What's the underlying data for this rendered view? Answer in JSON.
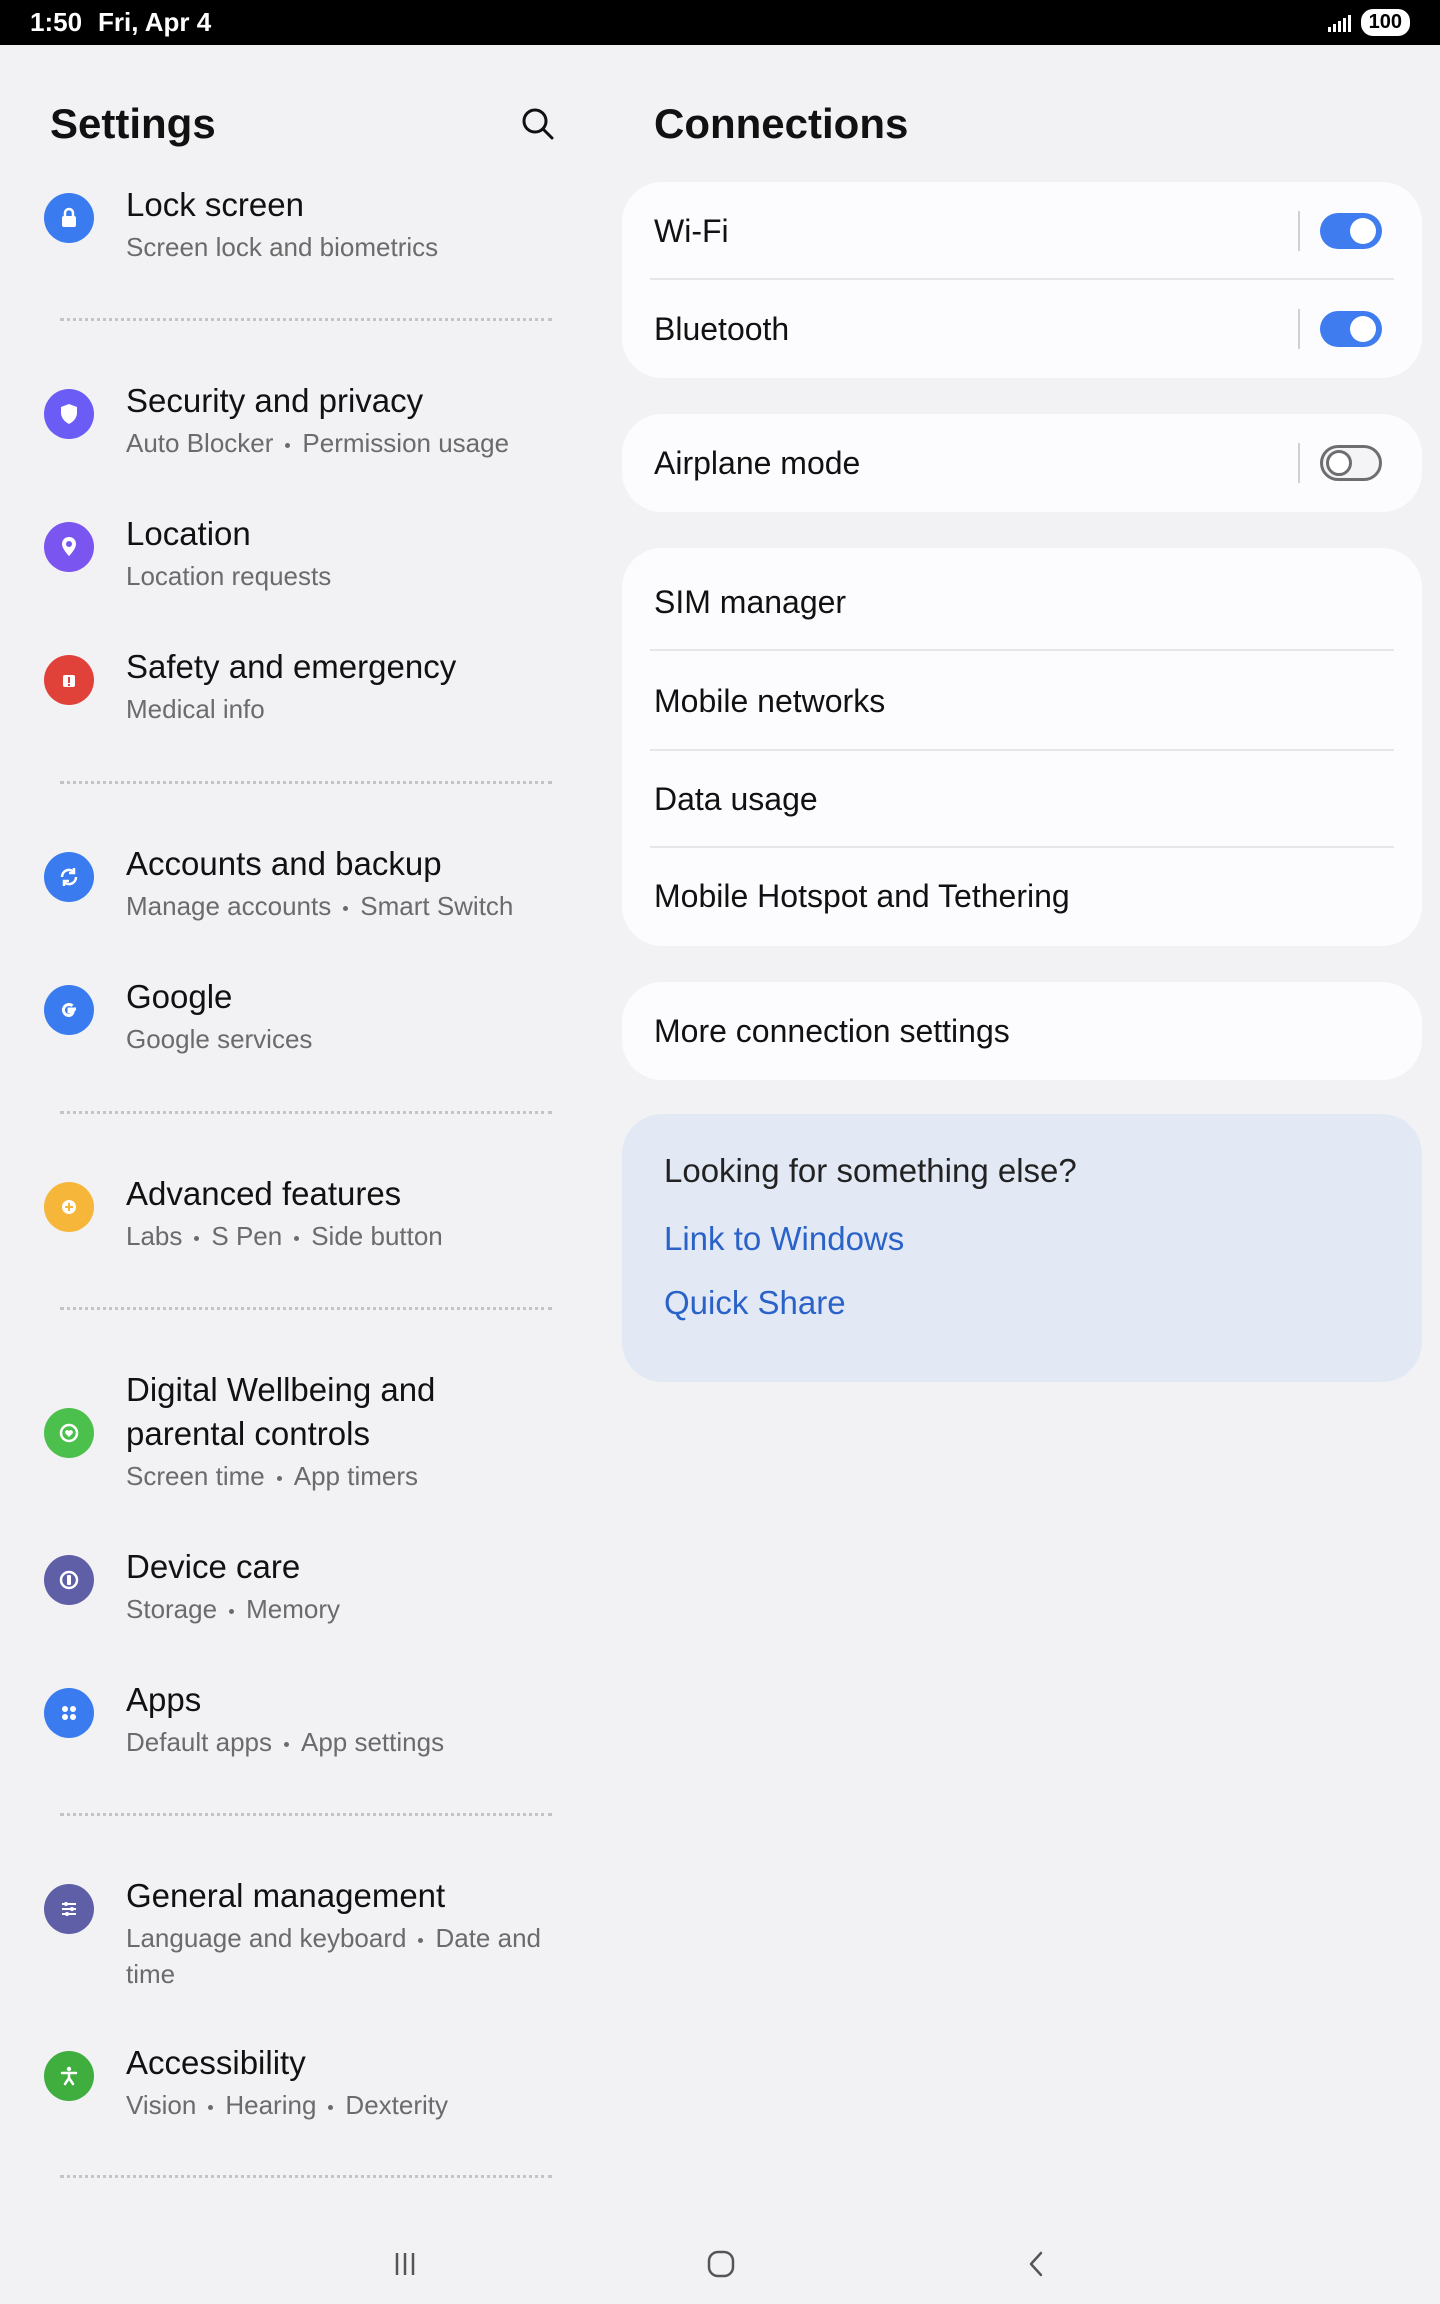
{
  "status": {
    "time": "1:50",
    "date": "Fri, Apr 4",
    "battery": "100"
  },
  "settings": {
    "title": "Settings",
    "items": [
      {
        "title": "Lock screen",
        "sub": [
          "Screen lock and biometrics"
        ],
        "icon": "lock-icon",
        "color": "#3a7cf0"
      },
      {
        "title": "Security and privacy",
        "sub": [
          "Auto Blocker",
          "Permission usage"
        ],
        "icon": "shield-icon",
        "color": "#6a5cf5"
      },
      {
        "title": "Location",
        "sub": [
          "Location requests"
        ],
        "icon": "location-pin-icon",
        "color": "#7a55f0"
      },
      {
        "title": "Safety and emergency",
        "sub": [
          "Medical info"
        ],
        "icon": "emergency-icon",
        "color": "#e0423a"
      },
      {
        "title": "Accounts and backup",
        "sub": [
          "Manage accounts",
          "Smart Switch"
        ],
        "icon": "sync-icon",
        "color": "#3a7cf0"
      },
      {
        "title": "Google",
        "sub": [
          "Google services"
        ],
        "icon": "google-icon",
        "color": "#3a7cf0"
      },
      {
        "title": "Advanced features",
        "sub": [
          "Labs",
          "S Pen",
          "Side button"
        ],
        "icon": "gear-plus-icon",
        "color": "#f5b63a"
      },
      {
        "title": "Digital Wellbeing and parental controls",
        "sub": [
          "Screen time",
          "App timers"
        ],
        "icon": "wellbeing-icon",
        "color": "#4cc04c"
      },
      {
        "title": "Device care",
        "sub": [
          "Storage",
          "Memory"
        ],
        "icon": "device-care-icon",
        "color": "#5f5fa8"
      },
      {
        "title": "Apps",
        "sub": [
          "Default apps",
          "App settings"
        ],
        "icon": "apps-grid-icon",
        "color": "#3a7cf0"
      },
      {
        "title": "General management",
        "sub": [
          "Language and keyboard",
          "Date and time"
        ],
        "icon": "sliders-icon",
        "color": "#5f5fa8"
      },
      {
        "title": "Accessibility",
        "sub": [
          "Vision",
          "Hearing",
          "Dexterity"
        ],
        "icon": "accessibility-icon",
        "color": "#3fae3f"
      }
    ]
  },
  "connections": {
    "title": "Connections",
    "toggles": [
      {
        "label": "Wi-Fi",
        "on": true
      },
      {
        "label": "Bluetooth",
        "on": true
      }
    ],
    "airplane": {
      "label": "Airplane mode",
      "on": false
    },
    "network_items": [
      "SIM manager",
      "Mobile networks",
      "Data usage",
      "Mobile Hotspot and Tethering"
    ],
    "more": "More connection settings",
    "suggest": {
      "title": "Looking for something else?",
      "links": [
        "Link to Windows",
        "Quick Share"
      ]
    }
  },
  "nav": {
    "recents": "recents-icon",
    "home": "home-icon",
    "back": "back-icon"
  }
}
